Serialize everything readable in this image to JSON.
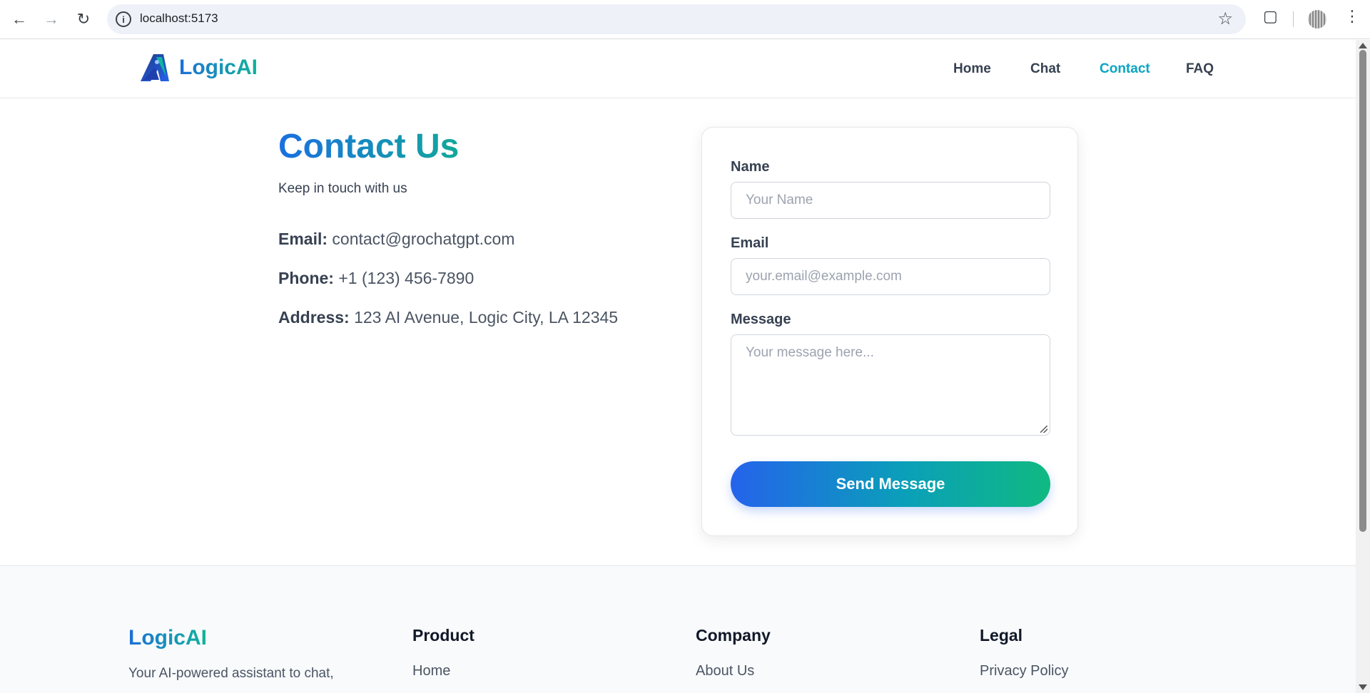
{
  "browser": {
    "url": "localhost:5173"
  },
  "header": {
    "brand": "LogicAI",
    "nav": [
      "Home",
      "Chat",
      "Contact",
      "FAQ"
    ],
    "active_nav": "Contact"
  },
  "contact": {
    "title": "Contact Us",
    "subtitle": "Keep in touch with us",
    "email_label": "Email:",
    "email_value": "contact@grochatgpt.com",
    "phone_label": "Phone:",
    "phone_value": "+1 (123) 456-7890",
    "address_label": "Address:",
    "address_value": "123 AI Avenue, Logic City, LA 12345"
  },
  "form": {
    "name_label": "Name",
    "name_placeholder": "Your Name",
    "email_label": "Email",
    "email_placeholder": "your.email@example.com",
    "message_label": "Message",
    "message_placeholder": "Your message here...",
    "submit_label": "Send Message"
  },
  "footer": {
    "brand": "LogicAI",
    "description": "Your AI-powered assistant to chat,",
    "columns": [
      {
        "title": "Product",
        "first_link": "Home"
      },
      {
        "title": "Company",
        "first_link": "About Us"
      },
      {
        "title": "Legal",
        "first_link": "Privacy Policy"
      }
    ]
  },
  "colors": {
    "accent_blue": "#2563eb",
    "accent_green": "#10b981",
    "active_nav": "#0aa5c4"
  }
}
